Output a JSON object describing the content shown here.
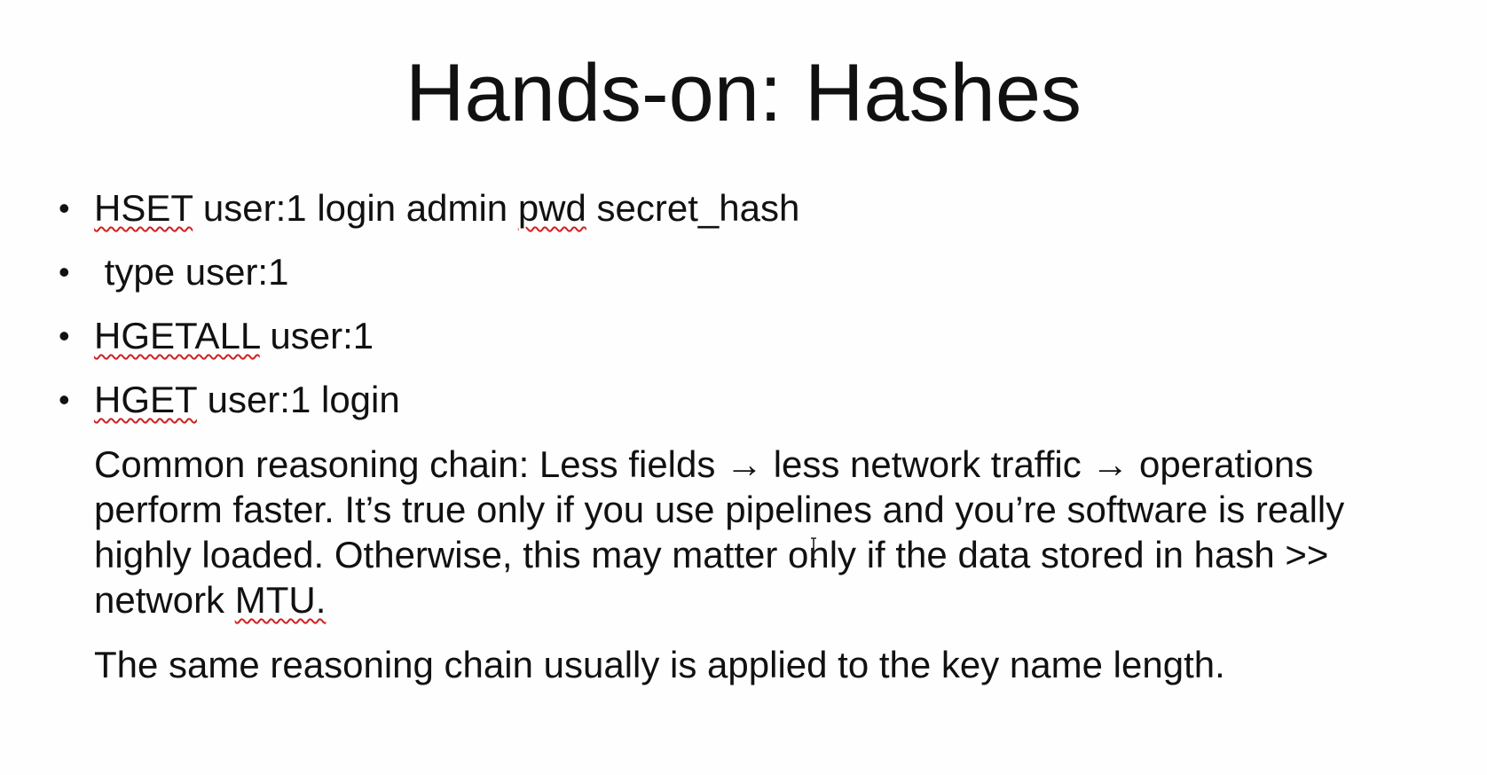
{
  "slide": {
    "title": "Hands-on: Hashes",
    "bullets": [
      {
        "cmd": "HSET",
        "rest_a": " user:1 login admin ",
        "word": "pwd",
        "rest_b": " secret_hash"
      },
      {
        "text": " type user:1"
      },
      {
        "cmd": "HGETALL",
        "rest_a": " user:1"
      },
      {
        "cmd": "HGET",
        "rest_a": " user:1 login"
      }
    ],
    "paragraph1": {
      "before": "Common reasoning chain: Less fields → less network traffic → operations perform faster. It’s true only if you use pipelines and you’re software is really highly loaded. Otherwise, this may matter only if the data stored in hash >> network ",
      "mtu": "MTU."
    },
    "paragraph2": "The same reasoning chain usually is applied to the key name length."
  },
  "bullet_glyph": "•",
  "icons": {
    "cursor": "text-cursor-icon"
  },
  "colors": {
    "background": "#fefefe",
    "text": "#111111",
    "spellcheck": "#d02020"
  }
}
